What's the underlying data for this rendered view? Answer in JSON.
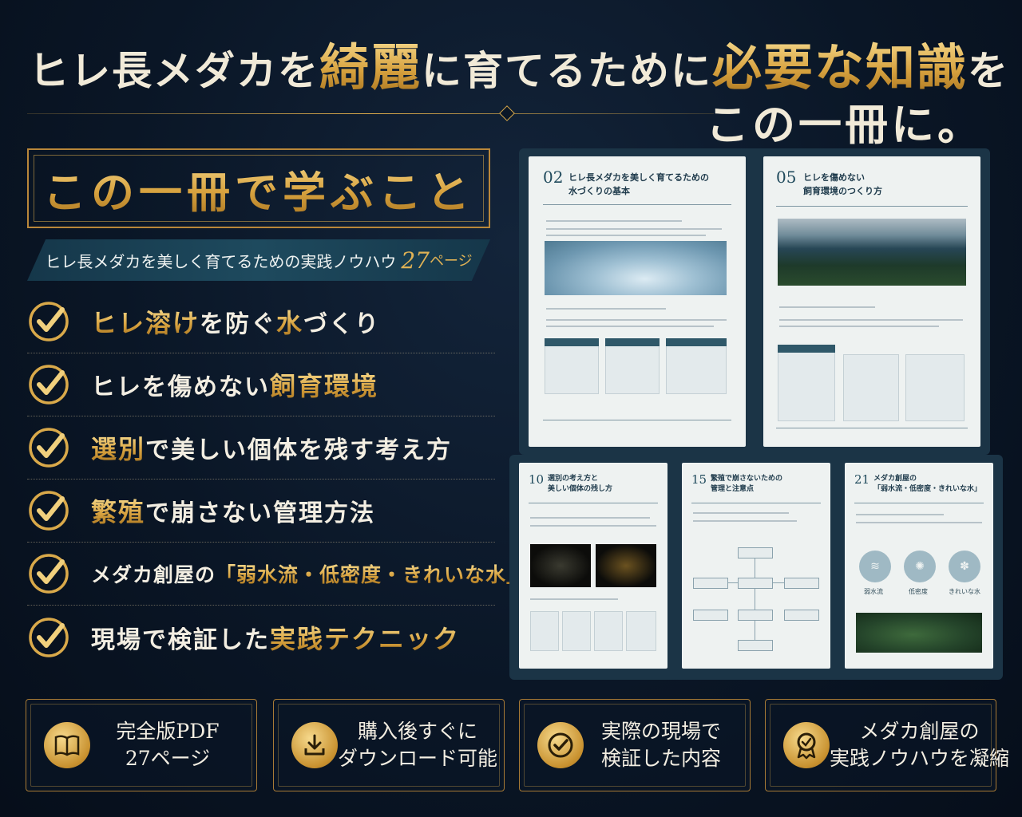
{
  "headline": {
    "part1": "ヒレ長メダカを",
    "part2": "綺麗",
    "part3": "に育てるために",
    "part4": "必要な知識",
    "part5": "を",
    "line2": "この一冊に。"
  },
  "learn": {
    "title": "この一冊で学ぶこと",
    "ribbon_text": "ヒレ長メダカを美しく育てるための実践ノウハウ",
    "ribbon_num": "27",
    "ribbon_unit": "ページ"
  },
  "checklist": [
    {
      "gold1": "ヒレ溶け",
      "plain1": "を防ぐ",
      "gold2": "水",
      "plain2": "づくり"
    },
    {
      "gold1": "",
      "plain1": "ヒレを傷めない",
      "gold2": "飼育環境",
      "plain2": ""
    },
    {
      "gold1": "選別",
      "plain1": "で美しい個体を残す考え方",
      "gold2": "",
      "plain2": ""
    },
    {
      "gold1": "繁殖",
      "plain1": "で崩さない管理方法",
      "gold2": "",
      "plain2": ""
    },
    {
      "gold1": "",
      "plain1": "メダカ創屋の",
      "gold2": "「弱水流・低密度・きれいな水」",
      "plain2": ""
    },
    {
      "gold1": "",
      "plain1": "現場で検証した",
      "gold2": "実践テクニック",
      "plain2": ""
    }
  ],
  "pages": [
    {
      "num": "02",
      "title1": "ヒレ長メダカを美しく育てるための",
      "title2": "水づくりの基本"
    },
    {
      "num": "05",
      "title1": "ヒレを傷めない",
      "title2": "飼育環境のつくり方"
    },
    {
      "num": "10",
      "title1": "選別の考え方と",
      "title2": "美しい個体の残し方"
    },
    {
      "num": "15",
      "title1": "繁殖で崩さないための",
      "title2": "管理と注意点"
    },
    {
      "num": "21",
      "title1": "メダカ創屋の",
      "title2": "「弱水流・低密度・きれいな水」"
    }
  ],
  "page21_labels": [
    "弱水流",
    "低密度",
    "きれいな水"
  ],
  "badges": [
    {
      "line1": "完全版PDF",
      "line2": "27ページ",
      "icon": "book-icon"
    },
    {
      "line1": "購入後すぐに",
      "line2": "ダウンロード可能",
      "icon": "download-icon"
    },
    {
      "line1": "実際の現場で",
      "line2": "検証した内容",
      "icon": "check-circle-icon"
    },
    {
      "line1": "メダカ創屋の",
      "line2": "実践ノウハウを凝縮",
      "icon": "award-ribbon-icon"
    }
  ],
  "colors": {
    "gold": "#d9a94a",
    "navy": "#0a1626",
    "teal": "#1e4a5e"
  }
}
